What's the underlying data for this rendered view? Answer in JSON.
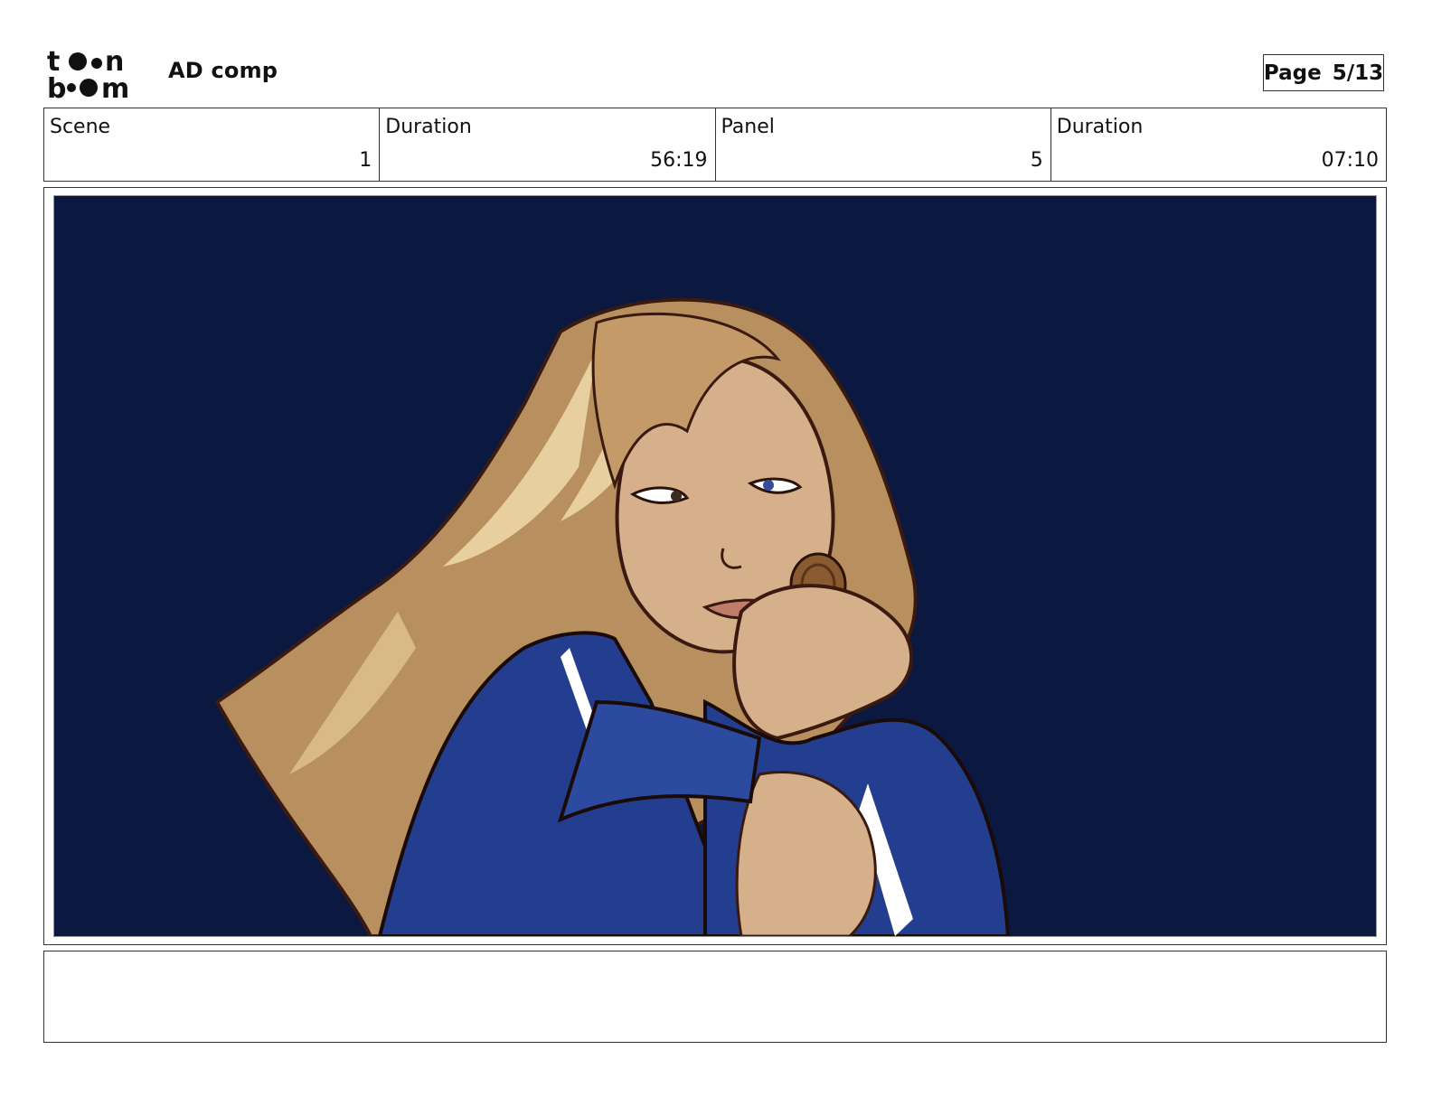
{
  "header": {
    "logo_name": "toon-boom-logo",
    "project_title": "AD comp",
    "page_label": "Page",
    "page_number": "5/13"
  },
  "info": {
    "scene_label": "Scene",
    "scene_value": "1",
    "scene_duration_label": "Duration",
    "scene_duration_value": "56:19",
    "panel_label": "Panel",
    "panel_value": "5",
    "panel_duration_label": "Duration",
    "panel_duration_value": "07:10"
  },
  "panel": {
    "image_name": "storyboard-panel-illustration",
    "background_color": "#0b1840"
  },
  "notes": {
    "text": ""
  }
}
